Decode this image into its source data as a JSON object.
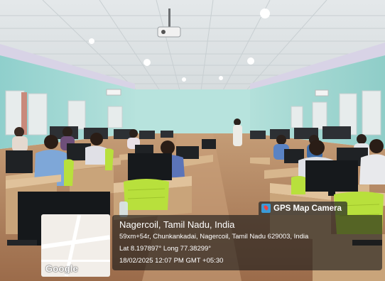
{
  "gps_badge": {
    "label": "GPS Map Camera",
    "icon": "gps-map-camera-icon"
  },
  "location": {
    "place": "Nagercoil, Tamil Nadu, India",
    "address": "59xm+54r, Chunkankadai, Nagercoil, Tamil Nadu 629003, India",
    "coordinates": "Lat 8.197897° Long 77.38299°",
    "timestamp": "18/02/2025 12:07 PM GMT +05:30"
  },
  "map": {
    "logo": "Google"
  },
  "photo": {
    "subject": "computer lab",
    "colors": {
      "wall": "#a9dcd6",
      "ceiling": "#e8ecef",
      "floor": "#b98a63",
      "desk": "#d8b88f",
      "chair": "#b7e23d"
    }
  }
}
